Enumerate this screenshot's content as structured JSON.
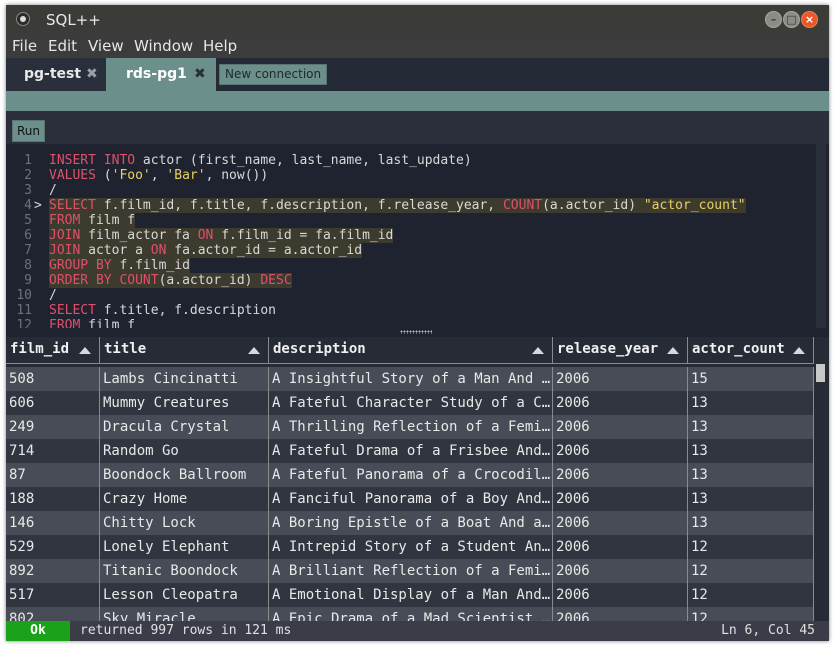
{
  "window": {
    "title": "SQL++"
  },
  "menu": [
    "File",
    "Edit",
    "View",
    "Window",
    "Help"
  ],
  "tabs": [
    {
      "label": "pg-test",
      "close": "✖"
    },
    {
      "label": "rds-pg1",
      "close": "✖"
    }
  ],
  "new_connection_label": "New connection",
  "run_label": "Run",
  "editor": {
    "current_line": 4,
    "lines": [
      {
        "n": "1",
        "hl": false,
        "tokens": [
          [
            "INSERT",
            "kw"
          ],
          [
            " ",
            ""
          ],
          [
            "INTO",
            "kw"
          ],
          [
            " actor (first_name, last_name, last_update)",
            ""
          ]
        ]
      },
      {
        "n": "2",
        "hl": false,
        "tokens": [
          [
            "VALUES",
            "kw"
          ],
          [
            " (",
            ""
          ],
          [
            "'Foo'",
            "st"
          ],
          [
            ", ",
            ""
          ],
          [
            "'Bar'",
            "st"
          ],
          [
            ", now())",
            ""
          ]
        ]
      },
      {
        "n": "3",
        "hl": false,
        "tokens": [
          [
            "/",
            ""
          ]
        ]
      },
      {
        "n": "4",
        "hl": true,
        "tokens": [
          [
            "SELECT",
            "kw"
          ],
          [
            " f.film_id, f.title, f.description, f.release_year, ",
            ""
          ],
          [
            "COUNT",
            "kw"
          ],
          [
            "(a.actor_id) ",
            ""
          ],
          [
            "\"actor_count\"",
            "st"
          ]
        ]
      },
      {
        "n": "5",
        "hl": true,
        "tokens": [
          [
            "FROM",
            "kw"
          ],
          [
            " film f",
            ""
          ]
        ]
      },
      {
        "n": "6",
        "hl": true,
        "tokens": [
          [
            "JOIN",
            "kw"
          ],
          [
            " film_actor fa ",
            ""
          ],
          [
            "ON",
            "kw"
          ],
          [
            " f.film_id = fa.film_id",
            ""
          ]
        ]
      },
      {
        "n": "7",
        "hl": true,
        "tokens": [
          [
            "JOIN",
            "kw"
          ],
          [
            " actor a ",
            ""
          ],
          [
            "ON",
            "kw"
          ],
          [
            " fa.actor_id = a.actor_id",
            ""
          ]
        ]
      },
      {
        "n": "8",
        "hl": true,
        "tokens": [
          [
            "GROUP",
            "kw"
          ],
          [
            " ",
            ""
          ],
          [
            "BY",
            "kw"
          ],
          [
            " f.film_id",
            ""
          ]
        ]
      },
      {
        "n": "9",
        "hl": true,
        "tokens": [
          [
            "ORDER",
            "kw"
          ],
          [
            " ",
            ""
          ],
          [
            "BY",
            "kw"
          ],
          [
            " ",
            ""
          ],
          [
            "COUNT",
            "kw"
          ],
          [
            "(a.actor_id) ",
            ""
          ],
          [
            "DESC",
            "kw"
          ]
        ]
      },
      {
        "n": "10",
        "hl": false,
        "tokens": [
          [
            "/",
            ""
          ]
        ]
      },
      {
        "n": "11",
        "hl": false,
        "tokens": [
          [
            "SELECT",
            "kw"
          ],
          [
            " f.title, f.description",
            ""
          ]
        ]
      },
      {
        "n": "12",
        "hl": false,
        "tokens": [
          [
            "FROM",
            "kw"
          ],
          [
            " film f",
            ""
          ]
        ]
      }
    ]
  },
  "results": {
    "columns": [
      "film_id",
      "title",
      "description",
      "release_year",
      "actor_count"
    ],
    "rows": [
      [
        "508",
        "Lambs Cincinatti",
        "A Insightful Story of a Man And a Feminist",
        "2006",
        "15"
      ],
      [
        "606",
        "Mummy Creatures",
        "A Fateful Character Study of a Crocodile",
        "2006",
        "13"
      ],
      [
        "249",
        "Dracula Crystal",
        "A Thrilling Reflection of a Feminist",
        "2006",
        "13"
      ],
      [
        "714",
        "Random Go",
        "A Fateful Drama of a Frisbee And a Student",
        "2006",
        "13"
      ],
      [
        "87",
        "Boondock Ballroom",
        "A Fateful Panorama of a Crocodile And a Boy",
        "2006",
        "13"
      ],
      [
        "188",
        "Crazy Home",
        "A Fanciful Panorama of a Boy And a Woman",
        "2006",
        "13"
      ],
      [
        "146",
        "Chitty Lock",
        "A Boring Epistle of a Boat And a Database Administrator",
        "2006",
        "13"
      ],
      [
        "529",
        "Lonely Elephant",
        "A Intrepid Story of a Student And a Dog",
        "2006",
        "12"
      ],
      [
        "892",
        "Titanic Boondock",
        "A Brilliant Reflection of a Feminist And a Dog",
        "2006",
        "12"
      ],
      [
        "517",
        "Lesson Cleopatra",
        "A Emotional Display of a Man And a Explorer",
        "2006",
        "12"
      ],
      [
        "802",
        "Sky Miracle",
        "A Epic Drama of a Mad Scientist And a Explorer",
        "2006",
        "12"
      ]
    ]
  },
  "status": {
    "badge": "Ok",
    "message": "returned 997 rows in 121 ms",
    "position": "Ln 6, Col 45"
  },
  "colors": {
    "accent": "#6b8f8a",
    "keyword": "#e0506a",
    "string": "#e8d062",
    "ok": "#1aa31a"
  }
}
